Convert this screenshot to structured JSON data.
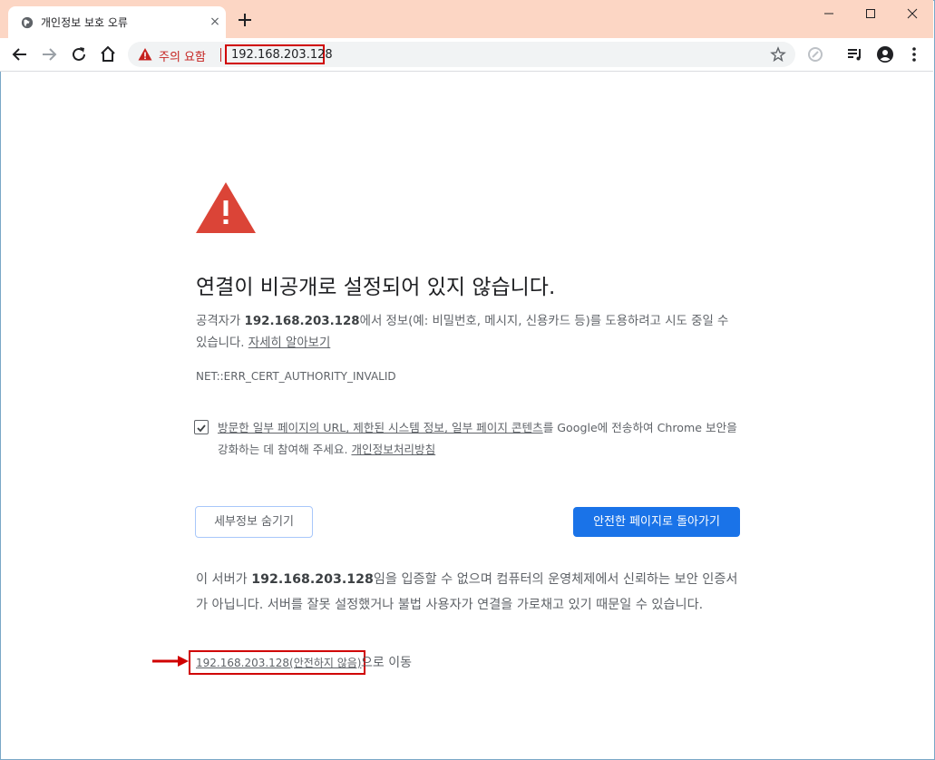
{
  "tab": {
    "title": "개인정보 보호 오류",
    "close": "×"
  },
  "omnibox": {
    "warning_label": "주의 요함",
    "url": "192.168.203.128"
  },
  "page": {
    "heading": "연결이 비공개로 설정되어 있지 않습니다.",
    "para1_pre": "공격자가 ",
    "para1_host": "192.168.203.128",
    "para1_post": "에서 정보(예: 비밀번호, 메시지, 신용카드 등)를 도용하려고 시도 중일 수 있습니다. ",
    "learn_more": "자세히 알아보기",
    "error_code": "NET::ERR_CERT_AUTHORITY_INVALID",
    "checkbox_link": "방문한 일부 페이지의 URL, 제한된 시스템 정보, 일부 페이지 콘텐츠",
    "checkbox_mid": "를 Google에 전송하여 Chrome 보안을 강화하는 데 참여해 주세요. ",
    "privacy_link": "개인정보처리방침",
    "hide_details": "세부정보 숨기기",
    "back_to_safety": "안전한 페이지로 돌아가기",
    "para2_pre": "이 서버가 ",
    "para2_host": "192.168.203.128",
    "para2_post": "임을 입증할 수 없으며 컴퓨터의 운영체제에서 신뢰하는 보안 인증서가 아닙니다. 서버를 잘못 설정했거나 불법 사용자가 연결을 가로채고 있기 때문일 수 있습니다.",
    "proceed_link": "192.168.203.128(안전하지 않음)",
    "proceed_suffix": "으로 이동"
  },
  "colors": {
    "titlebar": "#fcd6c4",
    "primary": "#1a73e8",
    "warning_red": "#db4437",
    "highlight": "#d00000"
  }
}
